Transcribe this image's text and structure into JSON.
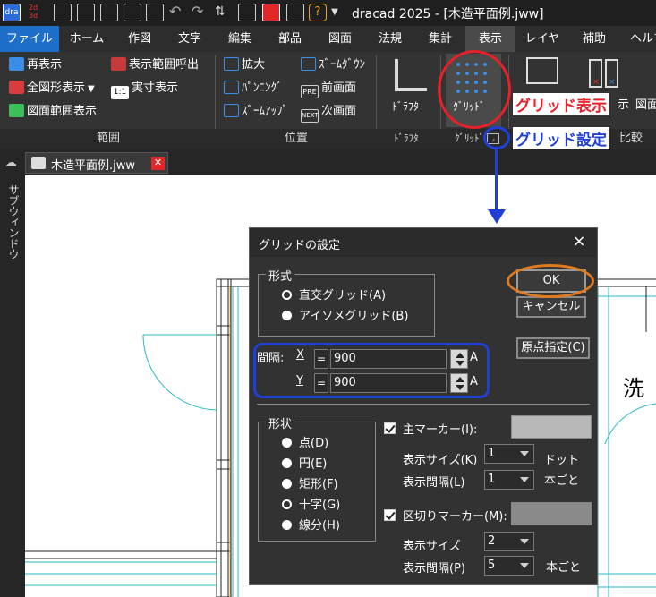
{
  "app": {
    "window_title": "dracad 2025 - [木造平面例.jww]"
  },
  "menu": {
    "items": [
      "ファイル",
      "ホーム",
      "作図",
      "文字",
      "編集",
      "部品",
      "図面",
      "法規",
      "集計",
      "表示",
      "レイヤ",
      "補助",
      "ヘルプ"
    ],
    "active": "表示"
  },
  "ribbon": {
    "range": {
      "items": [
        "再表示",
        "表示範囲呼出",
        "全図形表示",
        "実寸表示",
        "図面範囲表示"
      ],
      "group_label": "範囲"
    },
    "position": {
      "items": [
        "拡大",
        "ｽﾞｰﾑﾀﾞｳﾝ",
        "ﾊﾟﾝﾆﾝｸﾞ",
        "前画面",
        "ｽﾞｰﾑｱｯﾌﾟ",
        "次画面"
      ],
      "group_label": "位置",
      "icon_text_prev": "PRE",
      "icon_text_next": "NEXT",
      "icon_text_1to1": "1:1"
    },
    "drafter": {
      "label": "ﾄﾞﾗﾌﾀ",
      "group_label": "ﾄﾞﾗﾌﾀ"
    },
    "grid": {
      "label": "ｸﾞﾘｯﾄﾞ",
      "group_label": "ｸﾞﾘｯﾄﾞ"
    },
    "right_partial": {
      "label1": "示",
      "label2": "図面",
      "group_label": "比較"
    }
  },
  "annotations": {
    "grid_display": "グリッド表示",
    "grid_settings": "グリッド設定",
    "colors": {
      "red": "#e8202a",
      "blue": "#1f3fd8",
      "orange": "#e07a1f"
    }
  },
  "document": {
    "tab_label": "木造平面例.jww",
    "side_panel_label": "サブウィンドウ",
    "canvas_text": "洗"
  },
  "dialog": {
    "title": "グリッドの設定",
    "close": "×",
    "format": {
      "legend": "形式",
      "options": [
        "直交グリッド(A)",
        "アイソメグリッド(B)"
      ],
      "selected": "直交グリッド(A)"
    },
    "buttons": {
      "ok": "OK",
      "cancel": "キャンセル",
      "origin": "原点指定(C)"
    },
    "spacing": {
      "label": "間隔:",
      "x_label": "X",
      "y_label": "Y",
      "eq": "=",
      "x_value": "900",
      "y_value": "900",
      "unit": "A"
    },
    "shape": {
      "legend": "形状",
      "options": [
        "点(D)",
        "円(E)",
        "矩形(F)",
        "十字(G)",
        "線分(H)"
      ],
      "selected": "十字(G)"
    },
    "main_marker": {
      "label": "主マーカー(I):",
      "checked": true,
      "color": "#b8b8b8",
      "size_label": "表示サイズ(K)",
      "size_value": "1",
      "size_unit": "ドット",
      "interval_label": "表示間隔(L)",
      "interval_value": "1",
      "interval_unit": "本ごと"
    },
    "divider_marker": {
      "label": "区切りマーカー(M):",
      "checked": true,
      "color": "#8a8a8a",
      "size_label": "表示サイズ",
      "size_value": "2",
      "interval_label": "表示間隔(P)",
      "interval_value": "5",
      "interval_unit": "本ごと"
    }
  }
}
